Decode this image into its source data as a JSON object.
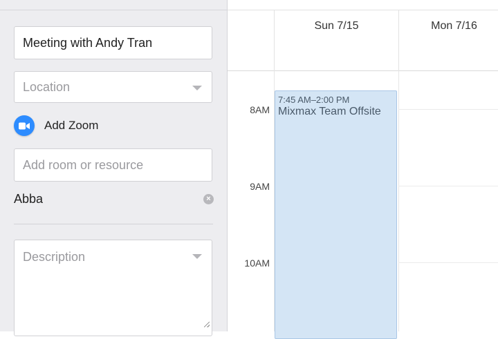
{
  "form": {
    "title_value": "Meeting with Andy Tran",
    "location_placeholder": "Location",
    "zoom_label": "Add Zoom",
    "room_placeholder": "Add room or resource",
    "resource_name": "Abba",
    "description_placeholder": "Description"
  },
  "calendar": {
    "days": [
      "Sun 7/15",
      "Mon 7/16"
    ],
    "hours": [
      "8AM",
      "9AM",
      "10AM"
    ],
    "event": {
      "time": "7:45 AM–2:00 PM",
      "title": "Mixmax Team Offsite",
      "color": "#d4e5f5"
    }
  },
  "icons": {
    "zoom": "video-camera-icon",
    "remove": "close-icon"
  },
  "colors": {
    "zoom_blue": "#2d8cff",
    "sidebar_bg": "#ededf0"
  }
}
